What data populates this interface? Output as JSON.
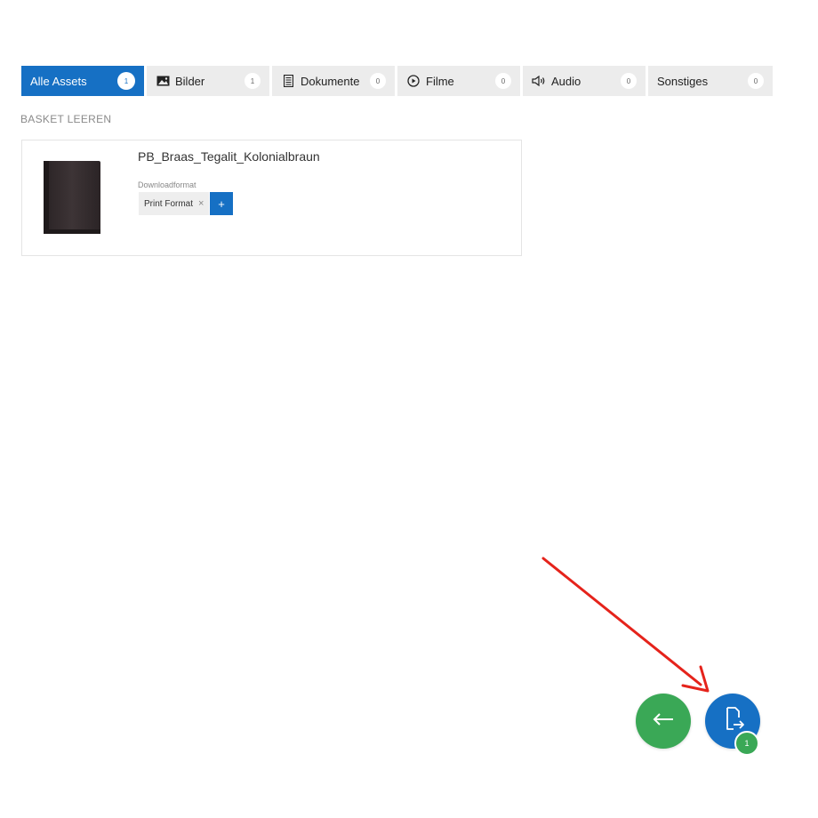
{
  "tabs": [
    {
      "label": "Alle Assets",
      "count": "1",
      "icon": ""
    },
    {
      "label": "Bilder",
      "count": "1",
      "icon": "image-icon"
    },
    {
      "label": "Dokumente",
      "count": "0",
      "icon": "document-icon"
    },
    {
      "label": "Filme",
      "count": "0",
      "icon": "play-circle-icon"
    },
    {
      "label": "Audio",
      "count": "0",
      "icon": "speaker-icon"
    },
    {
      "label": "Sonstiges",
      "count": "0",
      "icon": ""
    }
  ],
  "basket": {
    "clear_label": "BASKET LEEREN",
    "items": [
      {
        "title": "PB_Braas_Tegalit_Kolonialbraun",
        "format_label": "Downloadformat",
        "format_value": "Print Format",
        "remove_symbol": "×",
        "add_symbol": "+"
      }
    ]
  },
  "actions": {
    "back_icon": "arrow-left-icon",
    "download_icon": "download-export-icon",
    "download_badge": "1"
  },
  "colors": {
    "primary": "#1670c4",
    "success": "#3aa856",
    "tab_bg": "#ececec",
    "annotation": "#e5231b"
  }
}
